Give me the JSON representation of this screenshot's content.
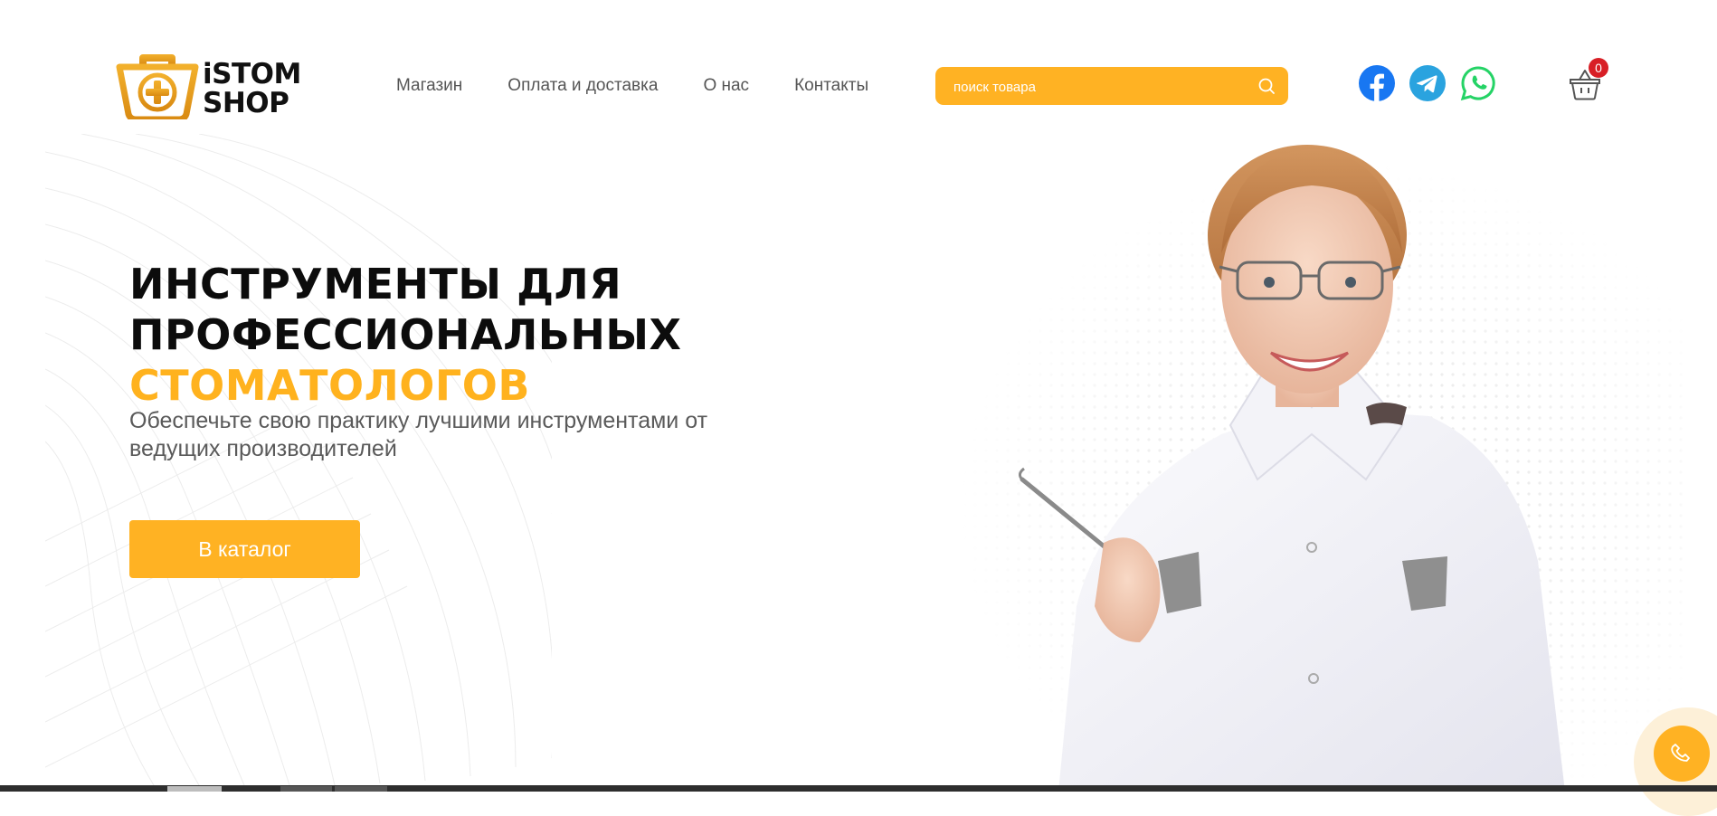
{
  "header": {
    "logo": {
      "line1": "iSTOM",
      "line2": "SHOP"
    },
    "nav": [
      "Магазин",
      "Оплата и доставка",
      "О нас",
      "Контакты"
    ],
    "search": {
      "placeholder": "поиск товара"
    },
    "social": [
      {
        "name": "facebook-icon",
        "color": "#1877f2"
      },
      {
        "name": "telegram-icon",
        "color": "#2aa3df"
      },
      {
        "name": "whatsapp-icon",
        "color": "#25d366"
      }
    ],
    "cart_count": "0"
  },
  "hero": {
    "title_line1": "ИНСТРУМЕНТЫ ДЛЯ",
    "title_line2": "ПРОФЕССИОНАЛЬНЫХ",
    "title_accent": "СТОМАТОЛОГОВ",
    "subtitle": "Обеспечьте свою практику лучшими инструментами от ведущих производителей",
    "cta_label": "В каталог"
  },
  "colors": {
    "accent": "#ffb223",
    "badge": "#d81f26",
    "title": "#0c0c0c"
  }
}
